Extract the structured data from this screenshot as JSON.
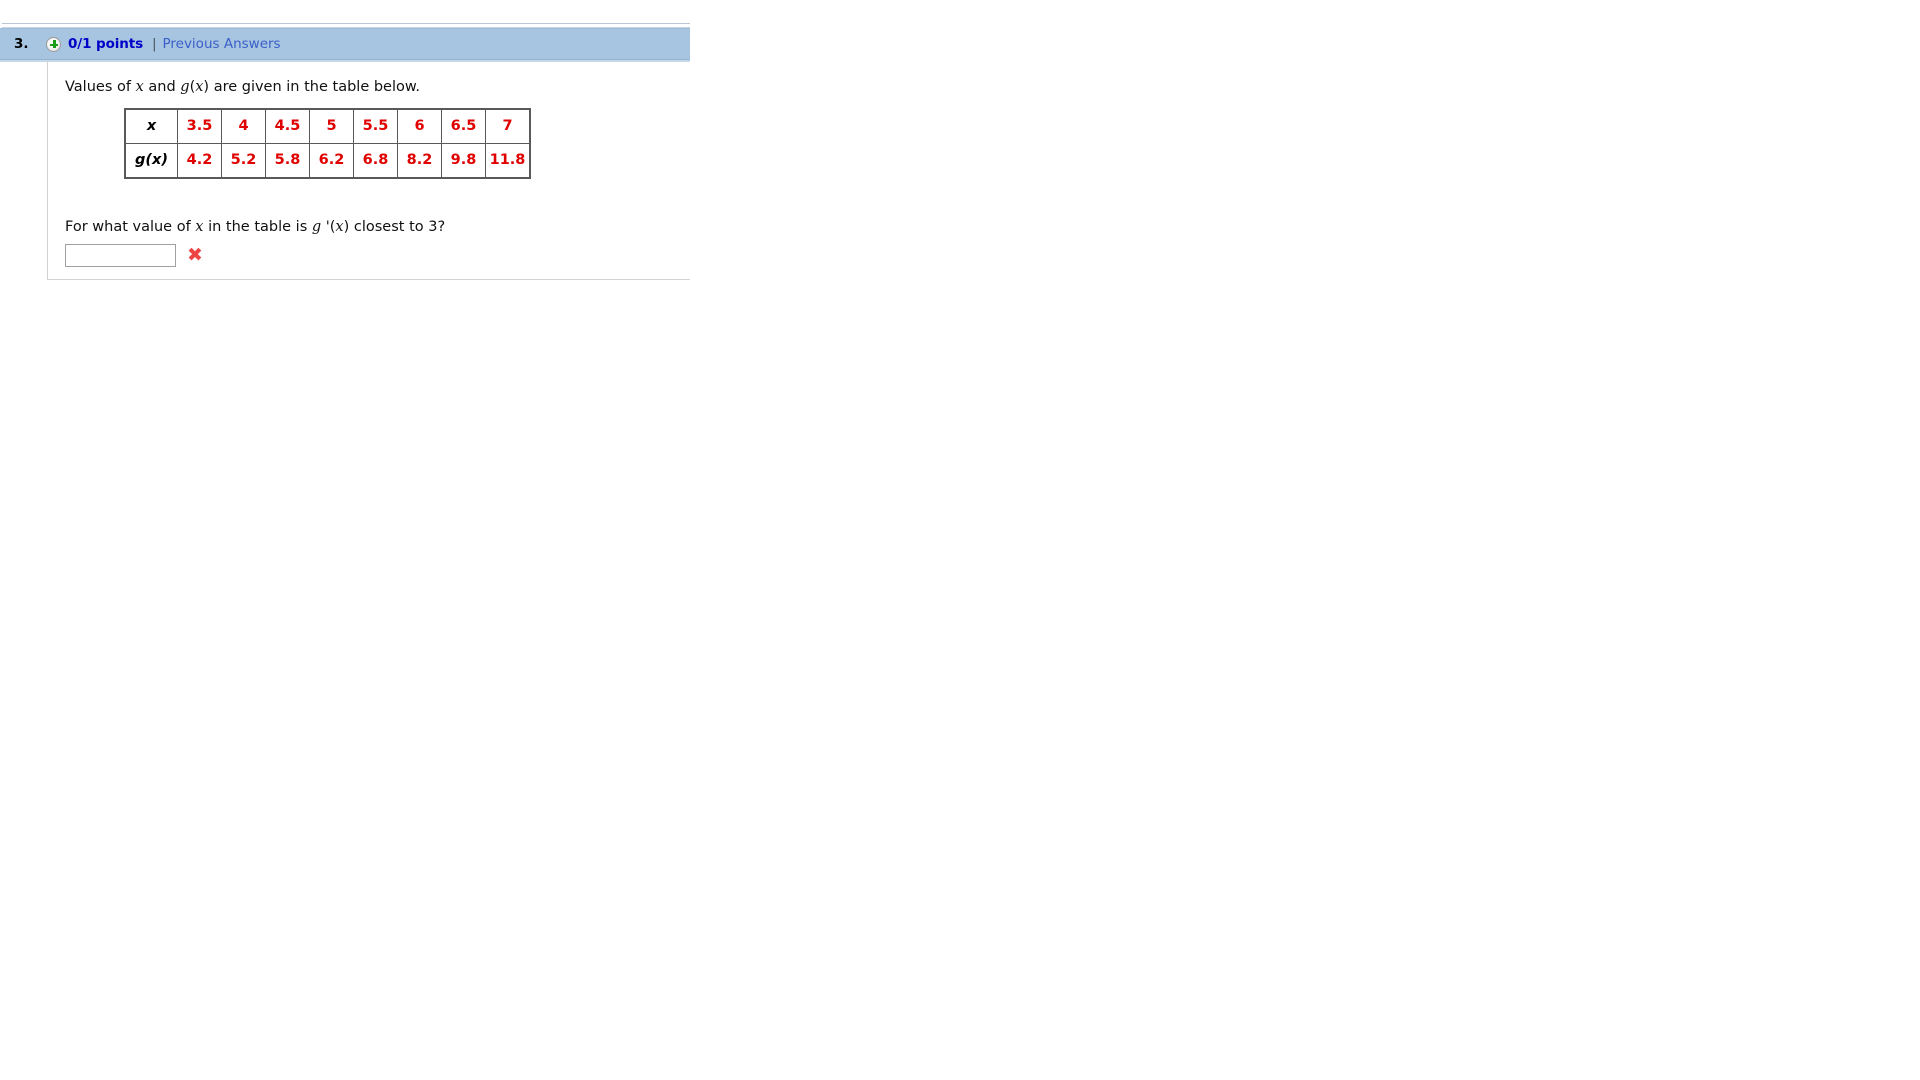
{
  "question": {
    "number": "3.",
    "plus_icon": "plus-circle-icon",
    "points": "0/1 points",
    "separator": "|",
    "previous_answers_label": "Previous Answers",
    "prompt": {
      "part1": "Values of ",
      "var_x": "x",
      "part2": " and ",
      "var_g": "g",
      "part3": "(",
      "var_x2": "x",
      "part4": ") are given in the table below."
    },
    "sub_question": {
      "part1": "For what value of ",
      "var_x": "x",
      "part2": " in the table is ",
      "var_g": "g",
      "part3": " '(",
      "var_x2": "x",
      "part4": ") closest to 3?"
    },
    "answer": {
      "value": "",
      "placeholder": "",
      "result_icon": "x-mark-incorrect-icon",
      "result_glyph": "✖"
    }
  },
  "table": {
    "row_headers": [
      "x",
      "g(x)"
    ],
    "x_values": [
      "3.5",
      "4",
      "4.5",
      "5",
      "5.5",
      "6",
      "6.5",
      "7"
    ],
    "g_values": [
      "4.2",
      "5.2",
      "5.8",
      "6.2",
      "6.8",
      "8.2",
      "9.8",
      "11.8"
    ]
  },
  "colors": {
    "header_bar": "#a7c5e0",
    "points_text": "#0000c8",
    "link_text": "#3a5fc8",
    "table_values": "#e00000",
    "incorrect_mark": "#ef4444",
    "plus_icon": "#1a9e1a"
  }
}
